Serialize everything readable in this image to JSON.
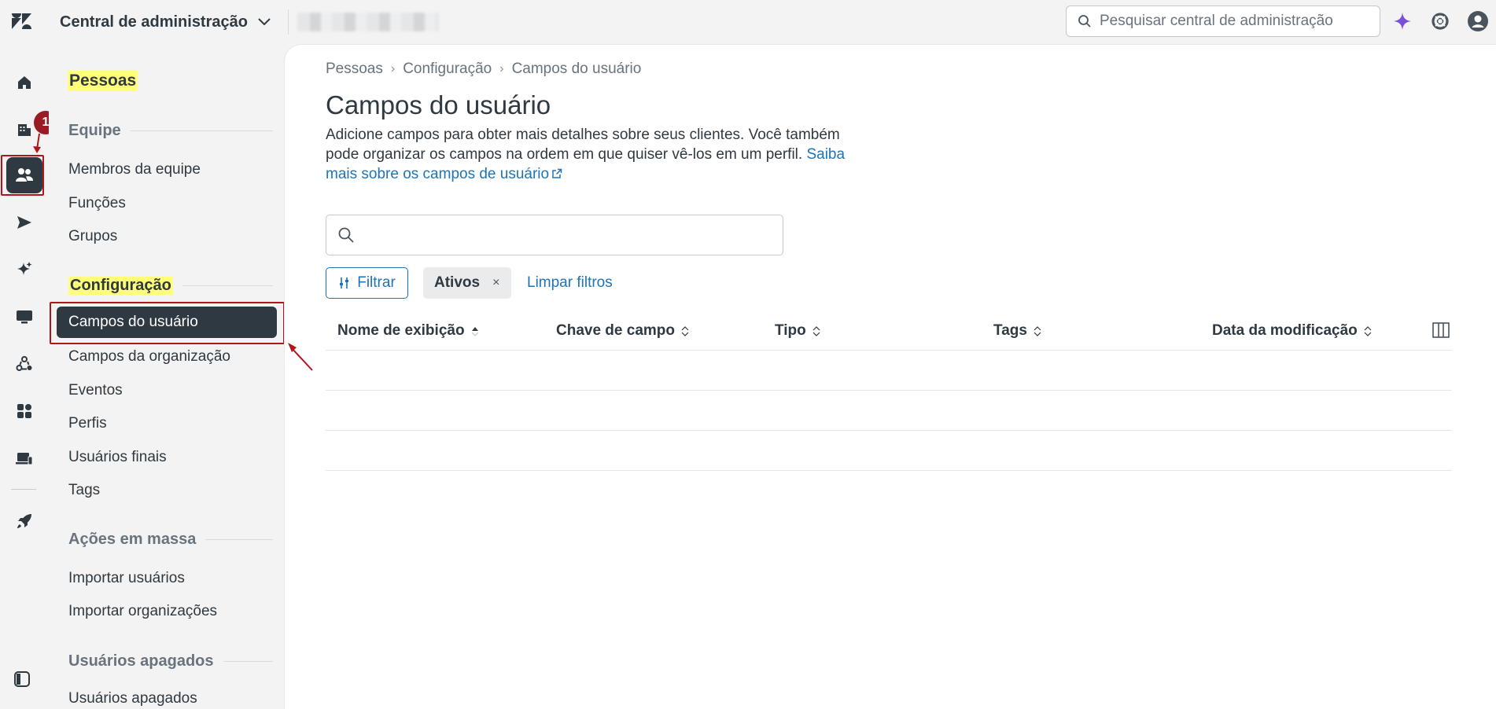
{
  "topbar": {
    "product_name": "Central de administração",
    "search_placeholder": "Pesquisar central de administração"
  },
  "rail": {
    "step_number": "1"
  },
  "subnav": {
    "title": "Pessoas",
    "sections": [
      {
        "label": "Equipe",
        "items": [
          "Membros da equipe",
          "Funções",
          "Grupos"
        ]
      },
      {
        "label": "Configuração",
        "items": [
          "Campos do usuário",
          "Campos da organização",
          "Eventos",
          "Perfis",
          "Usuários finais",
          "Tags"
        ]
      },
      {
        "label": "Ações em massa",
        "items": [
          "Importar usuários",
          "Importar organizações"
        ]
      },
      {
        "label": "Usuários apagados",
        "items": [
          "Usuários apagados"
        ]
      }
    ]
  },
  "main": {
    "breadcrumb": [
      "Pessoas",
      "Configuração",
      "Campos do usuário"
    ],
    "title": "Campos do usuário",
    "description": "Adicione campos para obter mais detalhes sobre seus clientes. Você também pode organizar os campos na ordem em que quiser vê-los em um perfil.",
    "learn_more": "Saiba mais sobre os campos de usuário",
    "filter_label": "Filtrar",
    "active_chip": "Ativos",
    "chip_remove": "×",
    "clear_filters": "Limpar filtros",
    "columns": [
      "Nome de exibição",
      "Chave de campo",
      "Tipo",
      "Tags",
      "Data da modificação"
    ]
  },
  "colors": {
    "accent": "#1f73b7",
    "highlight": "#ffff7a",
    "annotation": "#b3141c",
    "active_nav": "#2f3941"
  }
}
